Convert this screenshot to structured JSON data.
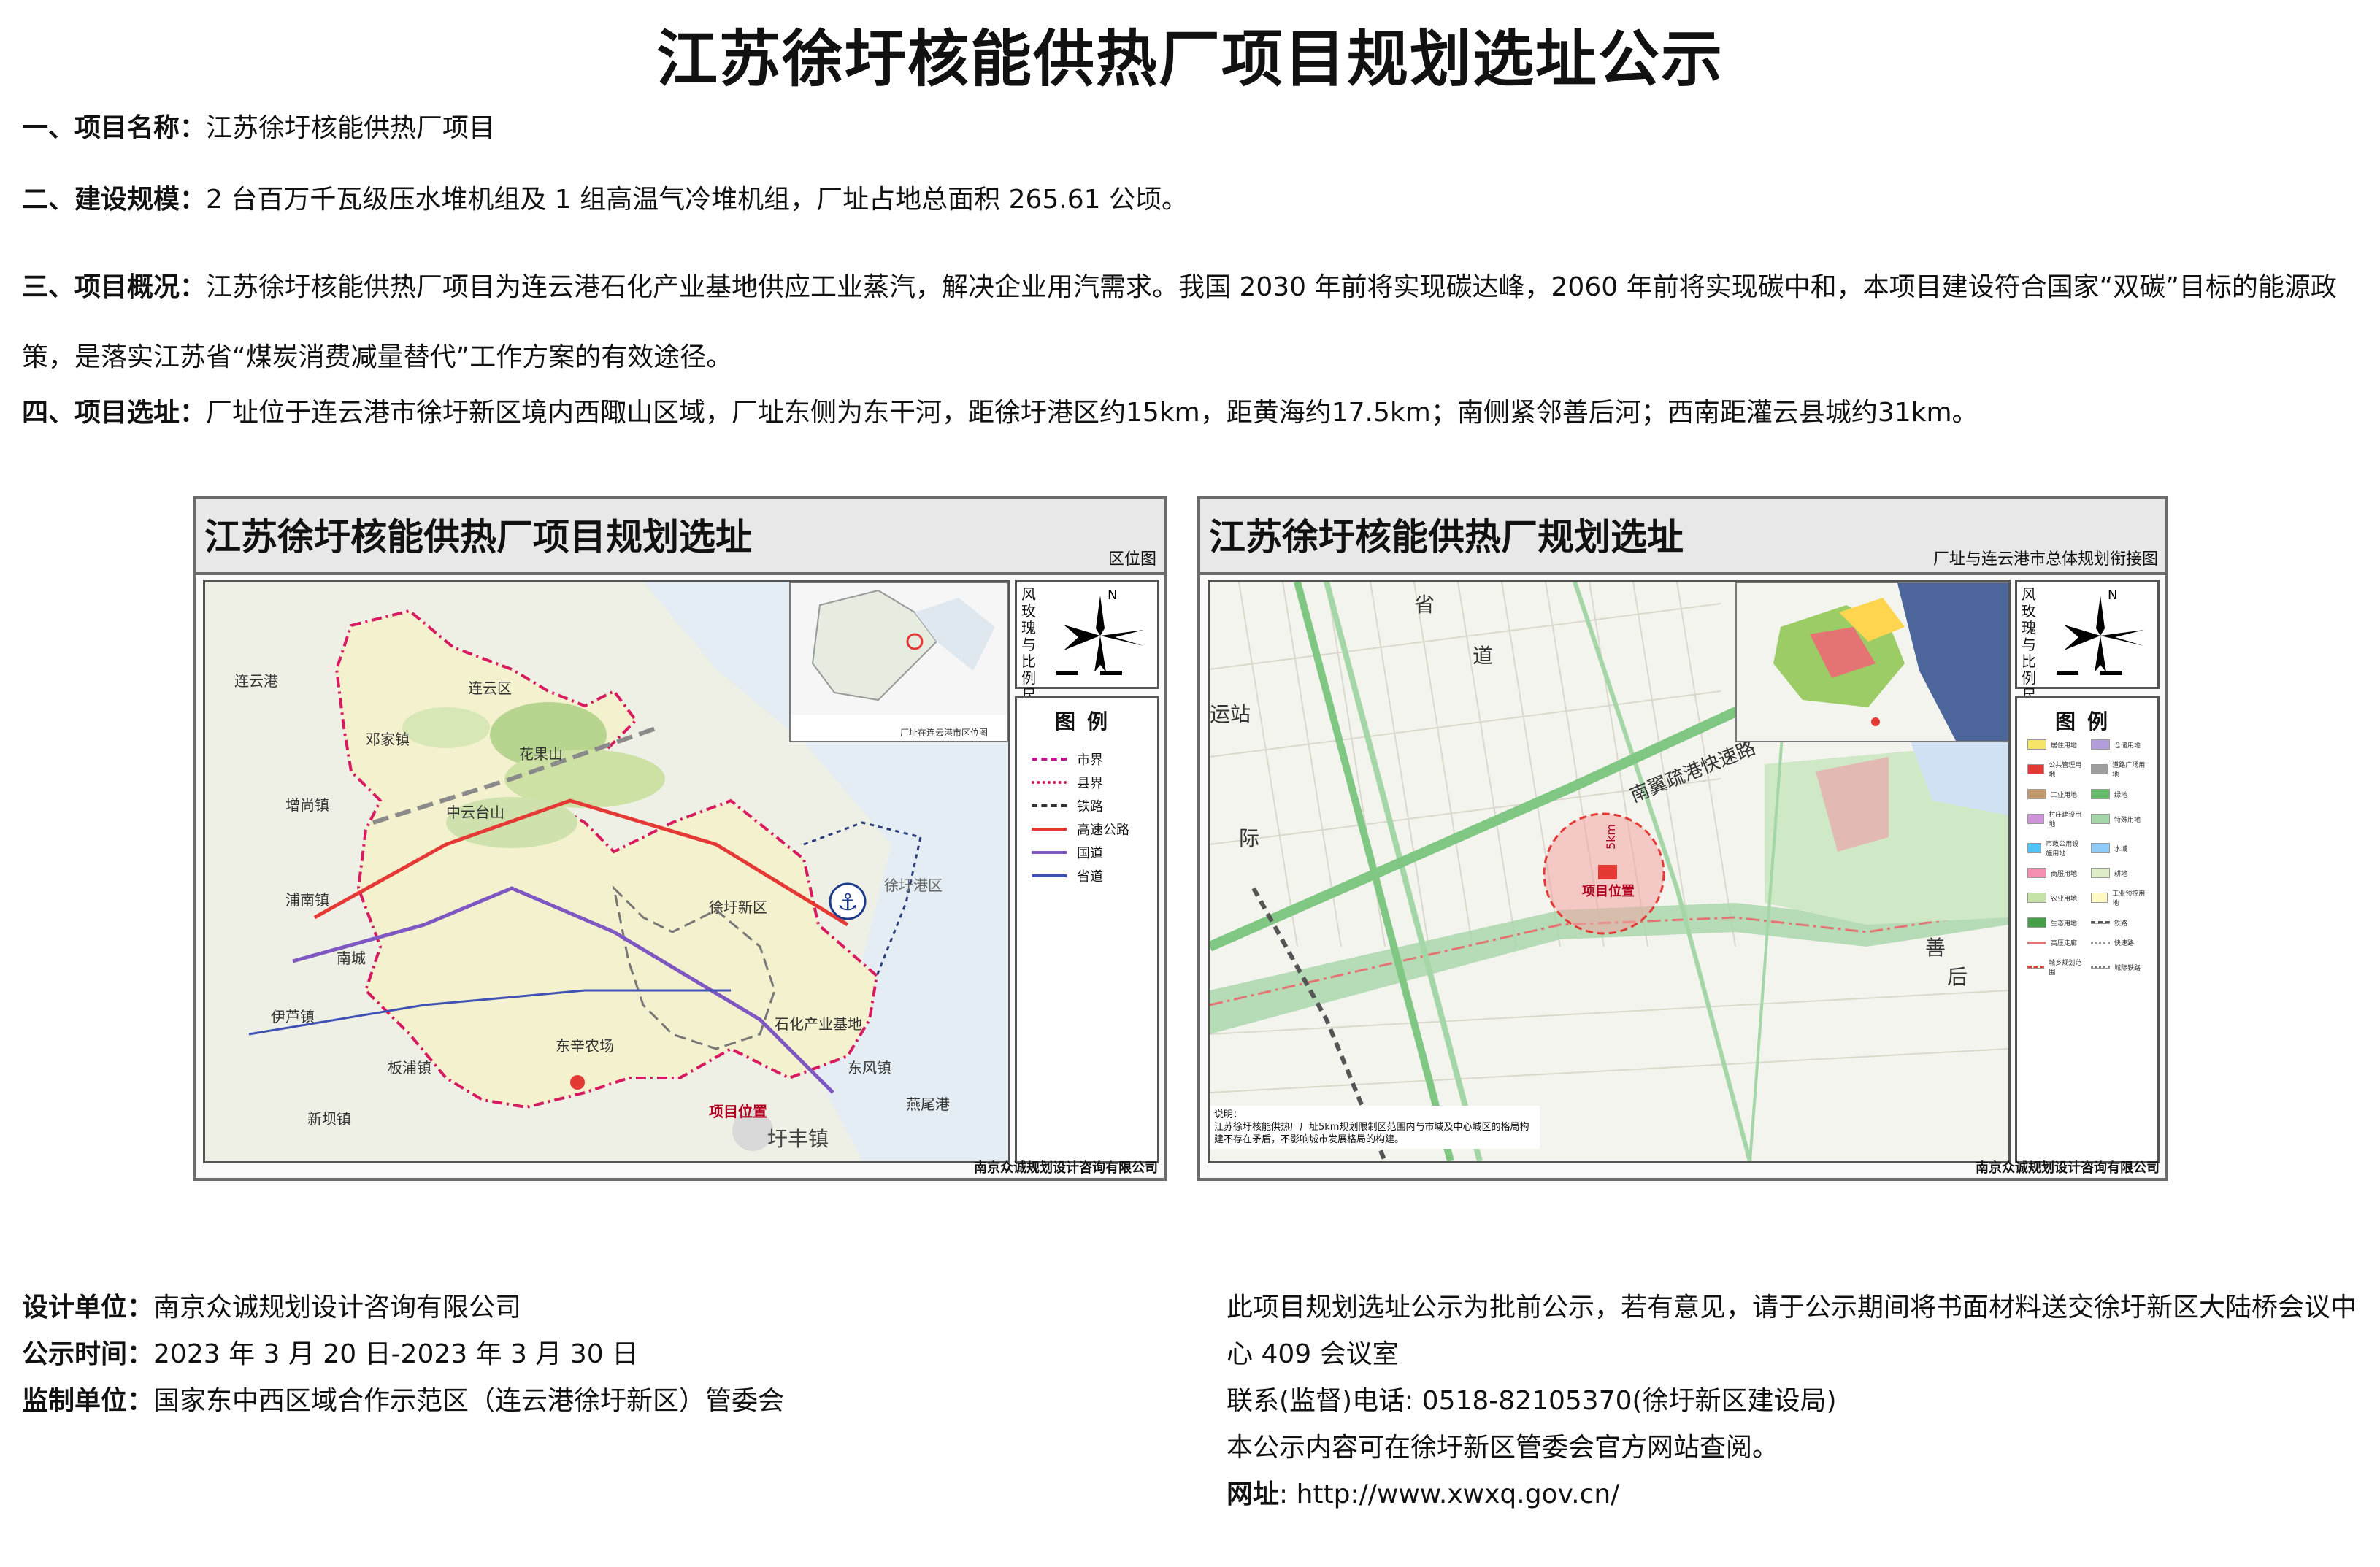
{
  "page_title": "江苏徐圩核能供热厂项目规划选址公示",
  "sections": [
    {
      "label": "一、项目名称：",
      "text": "江苏徐圩核能供热厂项目"
    },
    {
      "label": "二、建设规模：",
      "text": "2 台百万千瓦级压水堆机组及 1 组高温气冷堆机组，厂址占地总面积 265.61 公顷。"
    },
    {
      "label": "三、项目概况：",
      "text": "江苏徐圩核能供热厂项目为连云港石化产业基地供应工业蒸汽，解决企业用汽需求。我国 2030 年前将实现碳达峰，2060 年前将实现碳中和，本项目建设符合国家“双碳”目标的能源政策，是落实江苏省“煤炭消费减量替代”工作方案的有效途径。"
    },
    {
      "label": "四、项目选址：",
      "text": "厂址位于连云港市徐圩新区境内西陬山区域，厂址东侧为东干河，距徐圩港区约15km，距黄海约17.5km；南侧紧邻善后河；西南距灌云县城约31km。"
    }
  ],
  "map_left": {
    "title": "江苏徐圩核能供热厂项目规划选址",
    "subtitle": "区位图",
    "footer": "南京众诚规划设计咨询有限公司",
    "compass_label": "风玫瑰与比例尺",
    "legend_title": "图例",
    "legend": [
      {
        "label": "市界",
        "color": "#c2188f",
        "style": "dashed"
      },
      {
        "label": "县界",
        "color": "#d81b60",
        "style": "dashdot"
      },
      {
        "label": "铁路",
        "color": "#333333",
        "style": "dashed"
      },
      {
        "label": "高速公路",
        "color": "#e53935",
        "style": "solid"
      },
      {
        "label": "国道",
        "color": "#7e57c2",
        "style": "solid"
      },
      {
        "label": "省道",
        "color": "#3f51b5",
        "style": "solid"
      }
    ],
    "inset_caption": "厂址在连云港市区位图",
    "places": {
      "lianyun": "连云区",
      "yuntai": "云台山",
      "huaguo": "花果山",
      "zhongyun": "中云台山",
      "xuwei": "徐圩新区",
      "port": "徐圩港区",
      "petro": "石化产业基地",
      "dongxin": "东辛农场",
      "site": "项目位置",
      "weifeng": "圩丰镇",
      "banpu": "板浦镇",
      "zengxing": "增尚镇",
      "puxi": "浦南镇",
      "yuyou": "伊芦镇",
      "yanwei": "燕尾港",
      "dongfeng": "东风镇",
      "xunjia": "新坝镇",
      "dengjia": "邓家镇",
      "lianxi": "连云港",
      "baiyin": "南城"
    }
  },
  "map_right": {
    "title": "江苏徐圩核能供热厂规划选址",
    "subtitle": "厂址与连云港市总体规划衔接图",
    "footer": "南京众诚规划设计咨询有限公司",
    "compass_label": "风玫瑰与比例尺",
    "legend_title": "图例",
    "legend": [
      {
        "label": "居住用地",
        "color": "#f6e36a"
      },
      {
        "label": "仓储用地",
        "color": "#b39ddb"
      },
      {
        "label": "公共管理用地",
        "color": "#e53935"
      },
      {
        "label": "道路广场用地",
        "color": "#9e9e9e"
      },
      {
        "label": "工业用地",
        "color": "#c19a6b"
      },
      {
        "label": "绿地",
        "color": "#66bb6a"
      },
      {
        "label": "村庄建设用地",
        "color": "#ce93d8"
      },
      {
        "label": "特殊用地",
        "color": "#a5d6a7"
      },
      {
        "label": "市政公用设施用地",
        "color": "#4fc3f7"
      },
      {
        "label": "水域",
        "color": "#90caf9"
      },
      {
        "label": "商服用地",
        "color": "#f48fb1"
      },
      {
        "label": "耕地",
        "color": "#dcedc8"
      },
      {
        "label": "农业用地",
        "color": "#c5e1a5"
      },
      {
        "label": "工业预控用地",
        "color": "#fff9c4"
      },
      {
        "label": "生态用地",
        "color": "#43a047"
      },
      {
        "label": "铁路",
        "color": "#ffffff"
      },
      {
        "label": "高压走廊",
        "color": "#ffffff"
      },
      {
        "label": "快速路",
        "color": "#ffffff"
      },
      {
        "label": "城乡规划范围",
        "color": "#ffffff"
      },
      {
        "label": "城际铁路",
        "color": "#ffffff"
      }
    ],
    "map_labels": {
      "sheng": "省",
      "dao": "道",
      "yunzhan": "运站",
      "ji": "际",
      "expressway": "南翼疏港快速路",
      "shan": "善",
      "hou": "后",
      "site": "项目位置",
      "radius": "5km"
    },
    "note": "说明：\n江苏徐圩核能供热厂厂址5km规划限制区范围内与市域及中心城区的格局构建不存在矛盾，不影响城市发展格局的构建。"
  },
  "footer": {
    "design_label": "设计单位：",
    "design_value": "南京众诚规划设计咨询有限公司",
    "period_label": "公示时间：",
    "period_value": "2023 年 3 月 20 日-2023 年 3 月 30 日",
    "supervisor_label": "监制单位：",
    "supervisor_value": "国家东中西区域合作示范区（连云港徐圩新区）管委会",
    "notice": "此项目规划选址公示为批前公示，若有意见，请于公示期间将书面材料送交徐圩新区大陆桥会议中心 409 会议室",
    "phone": "联系(监督)电话: 0518-82105370(徐圩新区建设局)",
    "website_note": "本公示内容可在徐圩新区管委会官方网站查阅。",
    "url_label": "网址",
    "url_value": ": http://www.xwxq.gov.cn/"
  }
}
